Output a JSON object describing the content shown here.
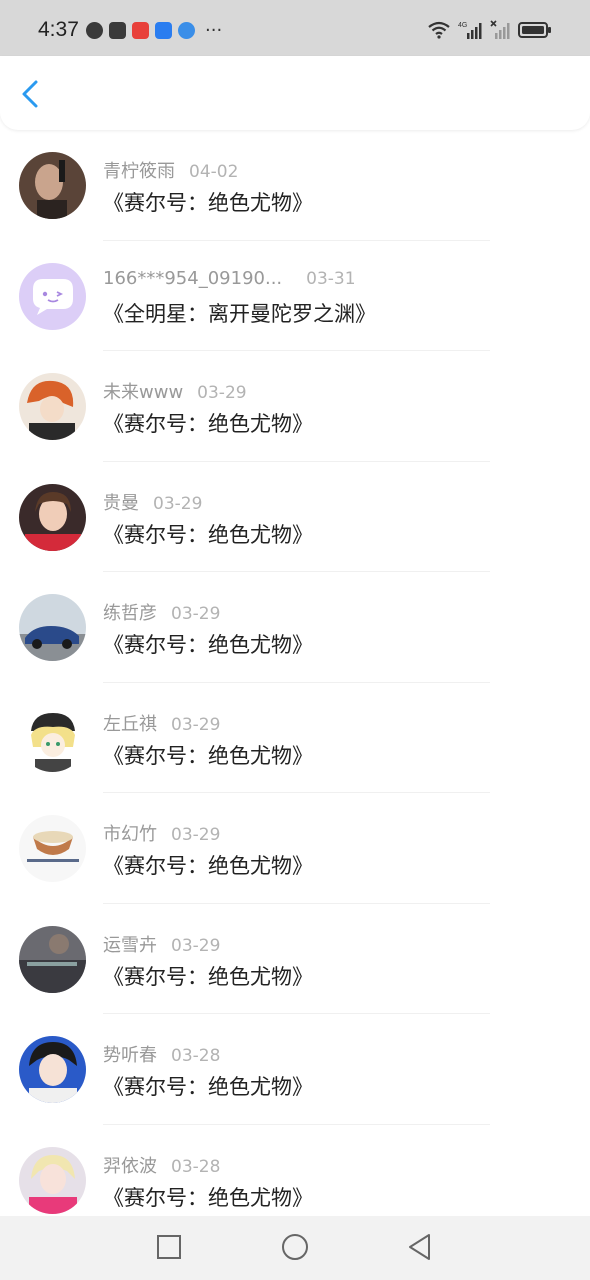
{
  "status_bar": {
    "time": "4:37",
    "more": "···",
    "network": "4G"
  },
  "header": {
    "back_icon": "chevron-left-icon",
    "accent_color": "#2a9af0"
  },
  "items": [
    {
      "name": "青柠筱雨",
      "date": "04-02",
      "title": "《赛尔号：绝色尤物》"
    },
    {
      "name": "166***954_09190...",
      "date": "03-31",
      "title": "《全明星：离开曼陀罗之渊》"
    },
    {
      "name": "未来www",
      "date": "03-29",
      "title": "《赛尔号：绝色尤物》"
    },
    {
      "name": "贵曼",
      "date": "03-29",
      "title": "《赛尔号：绝色尤物》"
    },
    {
      "name": "练哲彦",
      "date": "03-29",
      "title": "《赛尔号：绝色尤物》"
    },
    {
      "name": "左丘祺",
      "date": "03-29",
      "title": "《赛尔号：绝色尤物》"
    },
    {
      "name": "市幻竹",
      "date": "03-29",
      "title": "《赛尔号：绝色尤物》"
    },
    {
      "name": "运雪卉",
      "date": "03-29",
      "title": "《赛尔号：绝色尤物》"
    },
    {
      "name": "势听春",
      "date": "03-28",
      "title": "《赛尔号：绝色尤物》"
    },
    {
      "name": "羿依波",
      "date": "03-28",
      "title": "《赛尔号：绝色尤物》"
    }
  ],
  "nav_bar": {
    "recent_icon": "square-icon",
    "home_icon": "circle-icon",
    "back_icon": "triangle-back-icon"
  }
}
